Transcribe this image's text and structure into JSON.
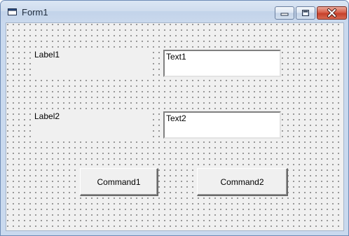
{
  "window": {
    "title": "Form1",
    "icon": "form-window-icon"
  },
  "caption_buttons": {
    "minimize": "minimize-icon",
    "maximize": "maximize-icon",
    "close": "close-icon"
  },
  "form": {
    "label1": "Label1",
    "label2": "Label2",
    "text1": "Text1",
    "text2": "Text2",
    "command1": "Command1",
    "command2": "Command2"
  },
  "colors": {
    "form_background": "#f0f0f0",
    "grid_dots": "#000000",
    "close_button": "#c6402a"
  }
}
